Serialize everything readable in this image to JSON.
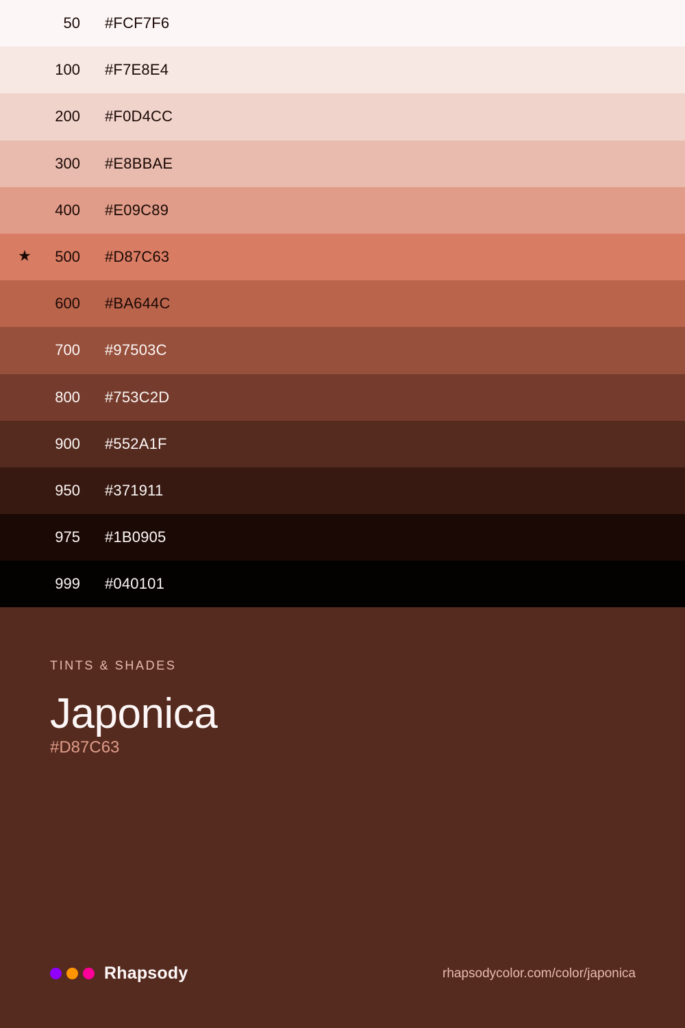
{
  "swatches": [
    {
      "step": "50",
      "hex": "#FCF7F6",
      "bg": "#FCF7F6",
      "text_color": "#1B0905",
      "star": ""
    },
    {
      "step": "100",
      "hex": "#F7E8E4",
      "bg": "#F7E8E4",
      "text_color": "#1B0905",
      "star": ""
    },
    {
      "step": "200",
      "hex": "#F0D4CC",
      "bg": "#F0D4CC",
      "text_color": "#1B0905",
      "star": ""
    },
    {
      "step": "300",
      "hex": "#E8BBAE",
      "bg": "#E8BBAE",
      "text_color": "#1B0905",
      "star": ""
    },
    {
      "step": "400",
      "hex": "#E09C89",
      "bg": "#E09C89",
      "text_color": "#1B0905",
      "star": ""
    },
    {
      "step": "500",
      "hex": "#D87C63",
      "bg": "#D87C63",
      "text_color": "#1B0905",
      "star": "★"
    },
    {
      "step": "600",
      "hex": "#BA644C",
      "bg": "#BA644C",
      "text_color": "#1B0905",
      "star": ""
    },
    {
      "step": "700",
      "hex": "#97503C",
      "bg": "#97503C",
      "text_color": "#FCF7F6",
      "star": ""
    },
    {
      "step": "800",
      "hex": "#753C2D",
      "bg": "#753C2D",
      "text_color": "#FCF7F6",
      "star": ""
    },
    {
      "step": "900",
      "hex": "#552A1F",
      "bg": "#552A1F",
      "text_color": "#FCF7F6",
      "star": ""
    },
    {
      "step": "950",
      "hex": "#371911",
      "bg": "#371911",
      "text_color": "#FCF7F6",
      "star": ""
    },
    {
      "step": "975",
      "hex": "#1B0905",
      "bg": "#1B0905",
      "text_color": "#FCF7F6",
      "star": ""
    },
    {
      "step": "999",
      "hex": "#040101",
      "bg": "#040101",
      "text_color": "#FCF7F6",
      "star": ""
    }
  ],
  "info": {
    "eyebrow": "TINTS & SHADES",
    "name": "Japonica",
    "hex": "#D87C63"
  },
  "footer": {
    "brand_name": "Rhapsody",
    "dots": [
      {
        "icon": "purple-dot-icon",
        "color": "#8F00FF"
      },
      {
        "icon": "orange-dot-icon",
        "color": "#FF9500"
      },
      {
        "icon": "pink-dot-icon",
        "color": "#FF0099"
      }
    ],
    "url": "rhapsodycolor.com/color/japonica"
  },
  "colors": {
    "page_background": "#552A1F",
    "eyebrow": "#E8BBAE",
    "name": "#FCF7F6",
    "hex": "#E09C89",
    "url": "#E8BBAE"
  }
}
